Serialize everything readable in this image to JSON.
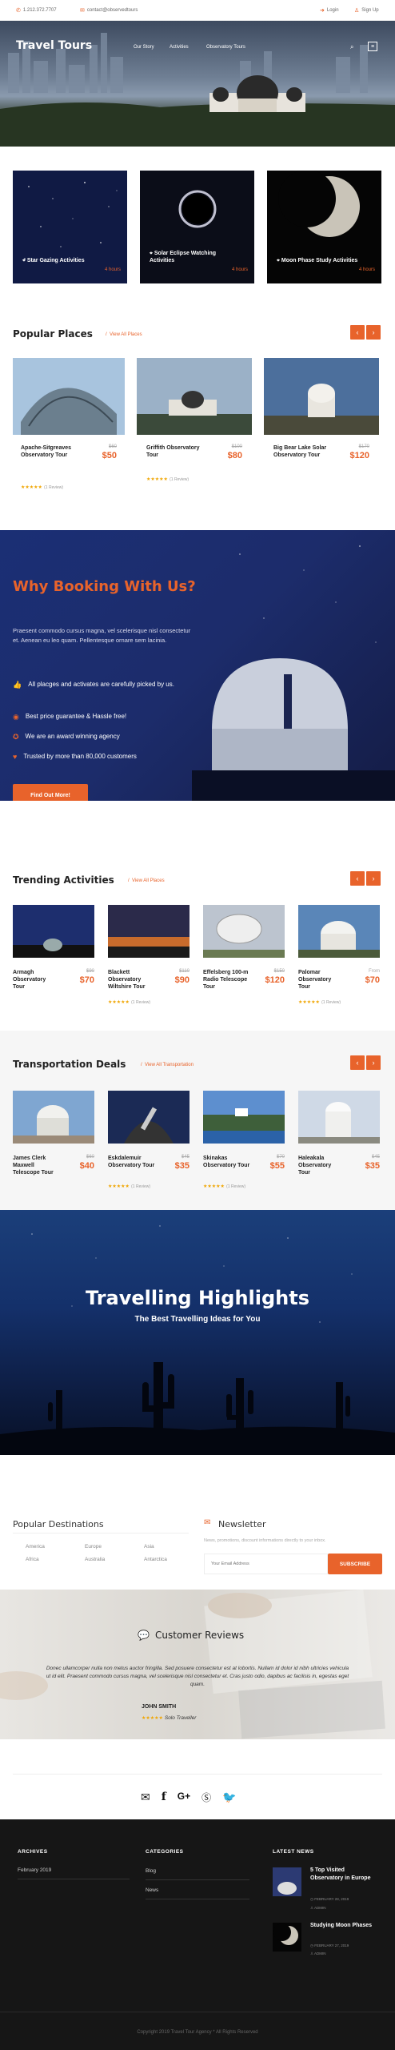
{
  "topbar": {
    "phone": "1.212.372.7707",
    "email": "contact@observedtours",
    "login": "Login",
    "signup": "Sign Up"
  },
  "header": {
    "logo": "Travel Tours",
    "nav": [
      "Our Story",
      "Activities",
      "Observatory Tours"
    ]
  },
  "categories": [
    {
      "title": "Star Gazing Activities",
      "hours": "4 hours"
    },
    {
      "title": "Solar Eclipse Watching Activities",
      "hours": "4 hours"
    },
    {
      "title": "Moon Phase Study Activities",
      "hours": "4 hours"
    }
  ],
  "popular": {
    "heading": "Popular Places",
    "view_all": "View All Places",
    "items": [
      {
        "title": "Apache-Sitgreaves Observatory Tour",
        "old": "$60",
        "price": "$50",
        "stars": "★★★★★",
        "reviews": "(1 Review)"
      },
      {
        "title": "Griffith Observatory Tour",
        "old": "$100",
        "price": "$80",
        "stars": "★★★★★",
        "reviews": "(1 Review)"
      },
      {
        "title": "Big Bear Lake Solar Observatory Tour",
        "old": "$170",
        "price": "$120",
        "stars": "",
        "reviews": ""
      }
    ]
  },
  "booking": {
    "heading": "Why Booking With Us?",
    "text": "Praesent commodo cursus magna, vel scelerisque nisl consectetur et. Aenean eu leo quam. Pellentesque ornare sem lacinia.",
    "items": [
      "All placges and activates are carefully picked by us.",
      "Best price guarantee & Hassle free!",
      "We are an award winning agency",
      "Trusted by more than 80,000 customers"
    ],
    "button": "Find Out More!"
  },
  "trending": {
    "heading": "Trending Activities",
    "view_all": "View All Places",
    "items": [
      {
        "title": "Armagh Observatory Tour",
        "old": "$90",
        "price": "$70",
        "stars": "",
        "reviews": ""
      },
      {
        "title": "Blackett Observatory Wiltshire Tour",
        "old": "$110",
        "price": "$90",
        "stars": "★★★★★",
        "reviews": "(1 Review)"
      },
      {
        "title": "Effelsberg 100-m Radio Telescope Tour",
        "old": "$150",
        "price": "$120",
        "stars": "",
        "reviews": ""
      },
      {
        "title": "Palomar Observatory Tour",
        "old": "From",
        "price": "$70",
        "stars": "★★★★★",
        "reviews": "(1 Review)"
      }
    ]
  },
  "transport": {
    "heading": "Transportation Deals",
    "view_all": "View All Transportation",
    "items": [
      {
        "title": "James Clerk Maxwell Telescope Tour",
        "old": "$60",
        "price": "$40",
        "stars": "",
        "reviews": ""
      },
      {
        "title": "Eskdalemuir Observatory Tour",
        "old": "$45",
        "price": "$35",
        "stars": "★★★★★",
        "reviews": "(1 Review)"
      },
      {
        "title": "Skinakas Observatory Tour",
        "old": "$70",
        "price": "$55",
        "stars": "★★★★★",
        "reviews": "(1 Review)"
      },
      {
        "title": "Haleakala Observatory Tour",
        "old": "$45",
        "price": "$35",
        "stars": "",
        "reviews": ""
      }
    ]
  },
  "highlights": {
    "title": "Travelling Highlights",
    "subtitle": "The Best Travelling Ideas for You"
  },
  "destinations": {
    "heading": "Popular Destinations",
    "col1": [
      "America",
      "Africa"
    ],
    "col2": [
      "Europe",
      "Australia"
    ],
    "col3": [
      "Asia",
      "Antarctica"
    ]
  },
  "newsletter": {
    "heading": "Newsletter",
    "text": "News, promotions, discount informations directly to your inbox.",
    "placeholder": "Your Email Address",
    "button": "SUBSCRIBE"
  },
  "reviews": {
    "heading": "Customer Reviews",
    "quote": "Donec ullamcorper nulla non metus auctor fringilla. Sed posuere consectetur est at lobortis. Nullam id dolor id nibh ultricies vehicula ut id elit. Praesent commodo cursus magna, vel scelerisque nisl consectetur et. Cras justo odio, dapibus ac facilisis in, egestas eget quam.",
    "name": "JOHN SMITH",
    "stars": "★★★★★",
    "role": "Solo Traveller"
  },
  "social": [
    "envelope-icon",
    "facebook-icon",
    "google-plus-icon",
    "skype-icon",
    "twitter-icon"
  ],
  "footer": {
    "archives_title": "ARCHIVES",
    "archives": [
      "February 2019"
    ],
    "categories_title": "CATEGORIES",
    "categories": [
      "Blog",
      "News"
    ],
    "news_title": "LATEST NEWS",
    "news": [
      {
        "title": "5 Top Visited Observatory in Europe",
        "date": "FEBRUARY 28, 2019",
        "admin": "ADMIN"
      },
      {
        "title": "Studying Moon Phases",
        "date": "FEBRUARY 27, 2019",
        "admin": "ADMIN"
      }
    ],
    "copyright": "Copyright 2019 Travel Tour Agency * All Rights Reserved"
  },
  "colors": {
    "accent": "#e8632b",
    "navy": "#1b2f75",
    "footer": "#161616"
  }
}
